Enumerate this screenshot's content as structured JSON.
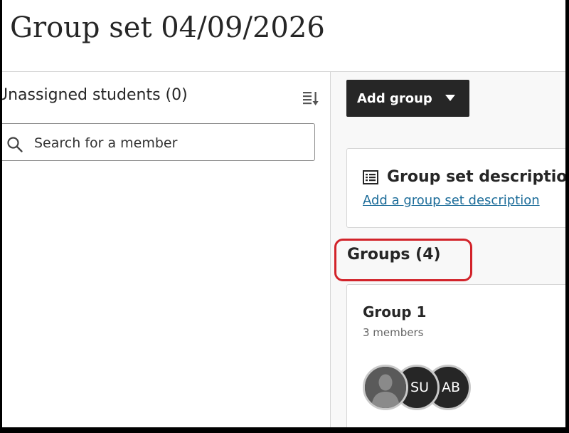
{
  "page": {
    "title": "Group set 04/09/2026"
  },
  "left_panel": {
    "heading": "Unassigned students (0)",
    "sort_icon": "sort-list-icon",
    "search": {
      "icon": "search-icon",
      "placeholder": "Search for a member",
      "value": ""
    }
  },
  "right_panel": {
    "add_group_label": "Add group",
    "description": {
      "icon": "list-icon",
      "title": "Group set description",
      "link": "Add a group set description"
    },
    "groups_heading": "Groups (4)",
    "highlight_color": "#d2232a",
    "groups": [
      {
        "name": "Group 1",
        "member_count": "3 members",
        "avatars": [
          {
            "initials": "",
            "type": "silhouette"
          },
          {
            "initials": "SU",
            "type": "initials"
          },
          {
            "initials": "AB",
            "type": "initials"
          }
        ]
      }
    ]
  },
  "colors": {
    "button_bg": "#262626",
    "link": "#1c6c99",
    "panel_bg": "#f8f8f8"
  }
}
